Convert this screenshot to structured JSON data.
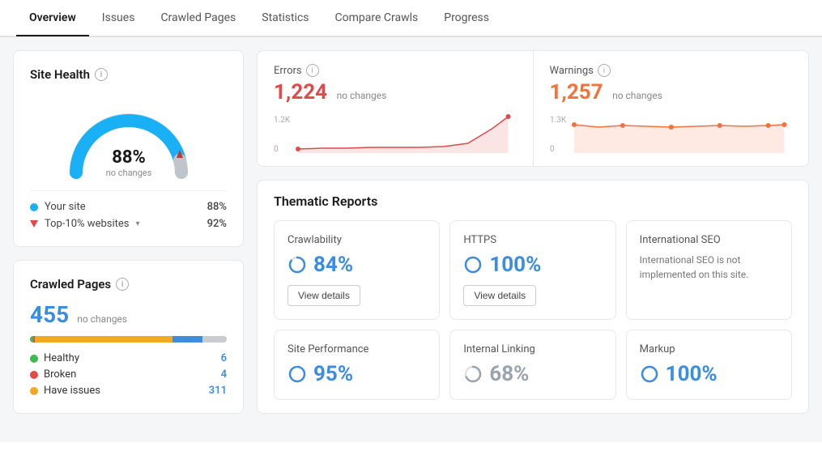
{
  "nav": {
    "tabs": [
      {
        "label": "Overview",
        "active": true
      },
      {
        "label": "Issues",
        "active": false
      },
      {
        "label": "Crawled Pages",
        "active": false
      },
      {
        "label": "Statistics",
        "active": false
      },
      {
        "label": "Compare Crawls",
        "active": false
      },
      {
        "label": "Progress",
        "active": false
      }
    ]
  },
  "siteHealth": {
    "title": "Site Health",
    "percent": "88%",
    "label": "no changes",
    "yourSite": {
      "label": "Your site",
      "value": "88%"
    },
    "top10": {
      "label": "Top-10% websites",
      "value": "92%"
    }
  },
  "crawledPages": {
    "title": "Crawled Pages",
    "count": "455",
    "noChanges": "no changes",
    "healthItems": [
      {
        "label": "Healthy",
        "count": "6",
        "colorClass": "dot-green"
      },
      {
        "label": "Broken",
        "count": "4",
        "colorClass": "dot-red"
      },
      {
        "label": "Have issues",
        "count": "311",
        "colorClass": "dot-orange"
      }
    ],
    "progressBar": {
      "green": 1.5,
      "red": 1,
      "orange": 70,
      "blue": 15,
      "gray": 12.5
    }
  },
  "errors": {
    "label": "Errors",
    "value": "1,224",
    "noChanges": "no changes",
    "chartScale": "1.2K",
    "chartZero": "0"
  },
  "warnings": {
    "label": "Warnings",
    "value": "1,257",
    "noChanges": "no changes",
    "chartScale": "1.3K",
    "chartZero": "0"
  },
  "thematicReports": {
    "title": "Thematic Reports",
    "reports": [
      {
        "name": "Crawlability",
        "percent": "84%",
        "hasButton": true,
        "buttonLabel": "View details",
        "colorClass": "blue"
      },
      {
        "name": "HTTPS",
        "percent": "100%",
        "hasButton": true,
        "buttonLabel": "View details",
        "colorClass": "blue"
      },
      {
        "name": "International SEO",
        "percent": null,
        "hasButton": false,
        "description": "International SEO is not implemented on this site.",
        "colorClass": "blue"
      },
      {
        "name": "Site Performance",
        "percent": "95%",
        "hasButton": false,
        "colorClass": "blue"
      },
      {
        "name": "Internal Linking",
        "percent": "68%",
        "hasButton": false,
        "colorClass": "gray"
      },
      {
        "name": "Markup",
        "percent": "100%",
        "hasButton": false,
        "colorClass": "blue"
      }
    ]
  }
}
